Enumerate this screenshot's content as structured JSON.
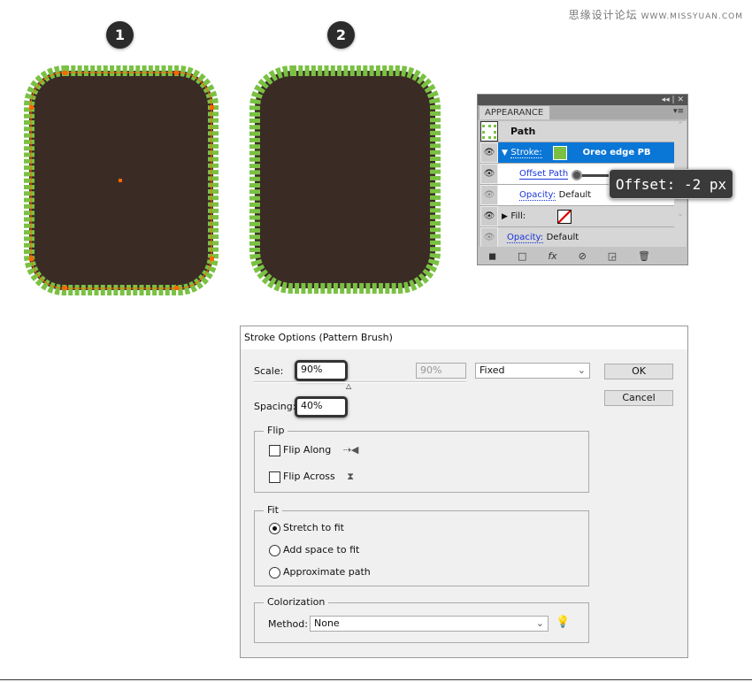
{
  "watermark": {
    "cn": "思缘设计论坛",
    "url": "WWW.MISSYUAN.COM"
  },
  "steps": [
    "1",
    "2"
  ],
  "colors": {
    "shape_fill": "#3a2b25",
    "bead": "#7ac143",
    "path": "#ff6600",
    "selection": "#0a76d6"
  },
  "appearance": {
    "panel_title": "APPEARANCE",
    "topbar": "◂◂ | ✕",
    "path_label": "Path",
    "stroke_label": "Stroke:",
    "brush_name": "Oreo edge PB",
    "offset_path": "Offset Path",
    "opacity_label": "Opacity:",
    "opacity_value": "Default",
    "fill_label": "Fill:",
    "opacity2_label": "Opacity:",
    "opacity2_value": "Default",
    "tooltip": "Offset: -2 px"
  },
  "dialog": {
    "title": "Stroke Options (Pattern Brush)",
    "scale_label": "Scale:",
    "scale_value": "90%",
    "scale_max": "90%",
    "scale_mode": "Fixed",
    "spacing_label": "Spacing:",
    "spacing_value": "40%",
    "ok": "OK",
    "cancel": "Cancel",
    "flip": {
      "title": "Flip",
      "along": "Flip Along",
      "across": "Flip Across",
      "along_checked": false,
      "across_checked": false
    },
    "fit": {
      "title": "Fit",
      "options": [
        "Stretch to fit",
        "Add space to fit",
        "Approximate path"
      ],
      "selected": 0
    },
    "colorization": {
      "title": "Colorization",
      "method_label": "Method:",
      "method_value": "None"
    }
  }
}
